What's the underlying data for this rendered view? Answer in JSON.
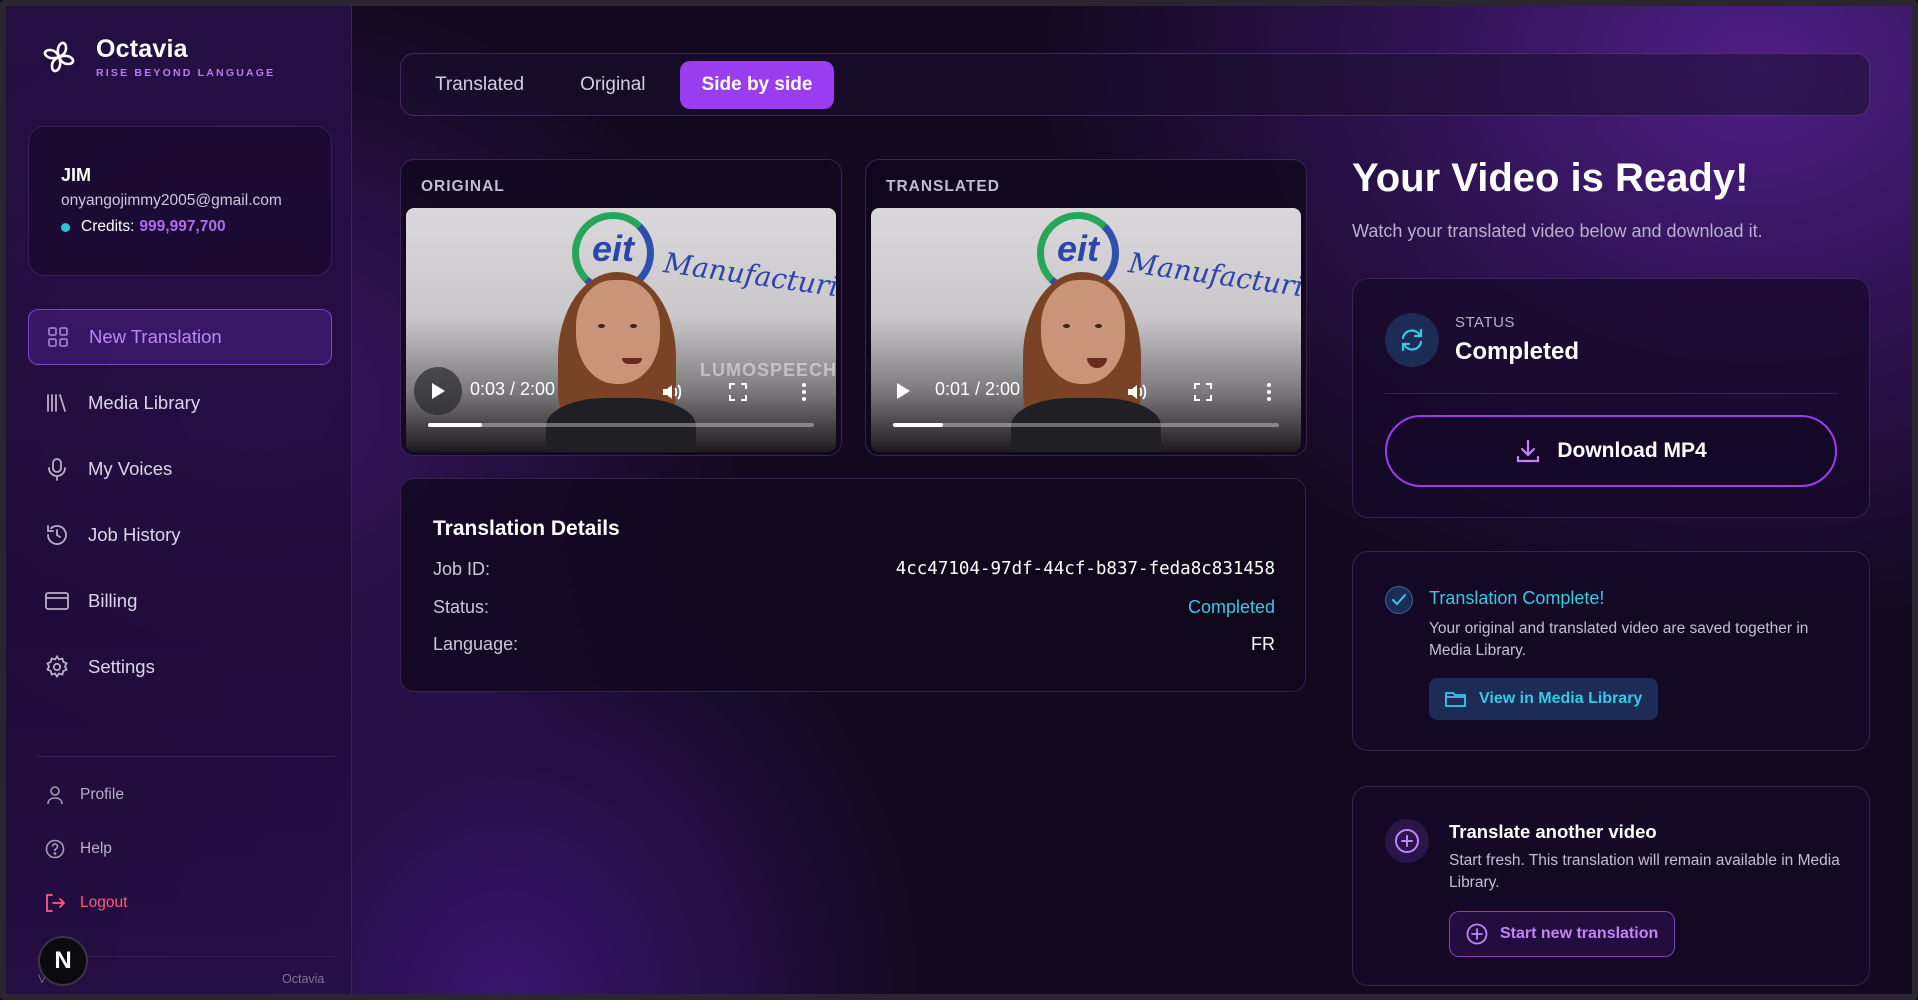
{
  "brand": {
    "name": "Octavia",
    "tagline": "RISE BEYOND LANGUAGE"
  },
  "user": {
    "name": "JIM",
    "email": "onyangojimmy2005@gmail.com",
    "credits_label": "Credits:",
    "credits_value": "999,997,700"
  },
  "nav": {
    "items": [
      {
        "label": "New Translation",
        "icon": "grid-icon",
        "active": true
      },
      {
        "label": "Media Library",
        "icon": "library-icon"
      },
      {
        "label": "My Voices",
        "icon": "microphone-icon"
      },
      {
        "label": "Job History",
        "icon": "history-icon"
      },
      {
        "label": "Billing",
        "icon": "credit-card-icon"
      },
      {
        "label": "Settings",
        "icon": "gear-icon"
      }
    ],
    "secondary": [
      {
        "label": "Profile",
        "icon": "user-icon"
      },
      {
        "label": "Help",
        "icon": "help-icon"
      },
      {
        "label": "Logout",
        "icon": "logout-icon"
      }
    ],
    "footer_left": "V",
    "footer_right": "Octavia",
    "badge": "N"
  },
  "tabs": [
    {
      "label": "Translated",
      "active": false
    },
    {
      "label": "Original",
      "active": false
    },
    {
      "label": "Side by side",
      "active": true
    }
  ],
  "videos": {
    "original": {
      "title": "ORIGINAL",
      "time": "0:03 / 2:00",
      "progress": 0.14,
      "overlay_text": "LUMOSPEECH",
      "logo_text": "eit",
      "brand_text": "Manufacturing"
    },
    "translated": {
      "title": "TRANSLATED",
      "time": "0:01 / 2:00",
      "progress": 0.13,
      "logo_text": "eit",
      "brand_text": "Manufacturing"
    }
  },
  "details": {
    "title": "Translation Details",
    "rows": [
      {
        "label": "Job ID:",
        "value": "4cc47104-97df-44cf-b837-feda8c831458"
      },
      {
        "label": "Status:",
        "value": "Completed"
      },
      {
        "label": "Language:",
        "value": "FR"
      }
    ]
  },
  "ready": {
    "title": "Your Video is Ready!",
    "subtitle": "Watch your translated video below and download it.",
    "status_label": "STATUS",
    "status_value": "Completed",
    "download_label": "Download MP4"
  },
  "complete": {
    "title": "Translation Complete!",
    "text": "Your original and translated video are saved together in Media Library.",
    "button": "View in Media Library"
  },
  "another": {
    "title": "Translate another video",
    "text": "Start fresh. This translation will remain available in Media Library.",
    "button": "Start new translation"
  },
  "colors": {
    "accent": "#9a3cf0",
    "cyan": "#3bc8e6",
    "logout": "#ff5c7d"
  }
}
